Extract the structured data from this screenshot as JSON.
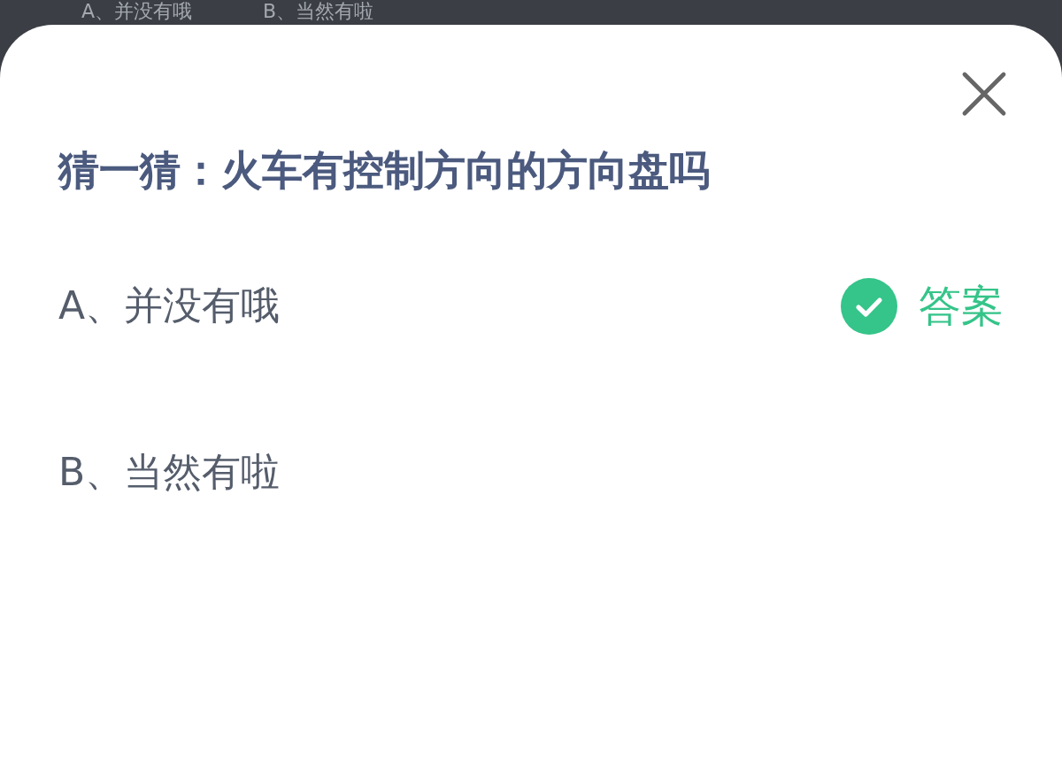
{
  "background_options": [
    "A、并没有哦",
    "B、当然有啦"
  ],
  "sheet": {
    "title": "猜一猜：火车有控制方向的方向盘吗",
    "answer_label": "答案",
    "options": [
      {
        "label": "A、并没有哦",
        "correct": true
      },
      {
        "label": "B、当然有啦",
        "correct": false
      }
    ]
  }
}
